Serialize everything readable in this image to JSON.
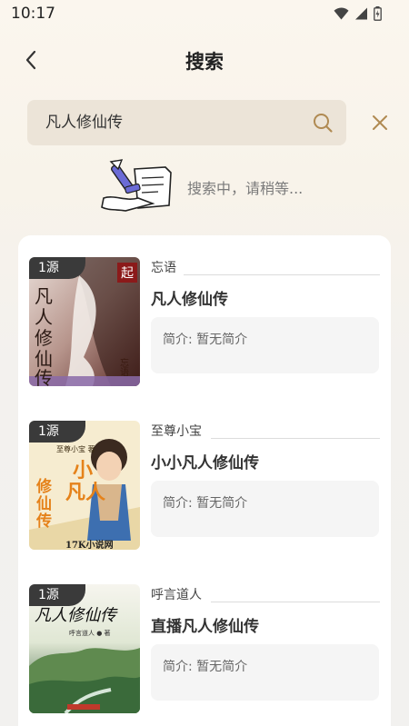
{
  "status_bar": {
    "time": "10:17"
  },
  "header": {
    "title": "搜索"
  },
  "search": {
    "query": "凡人修仙传"
  },
  "status": {
    "text": "搜索中，请稍等..."
  },
  "results": [
    {
      "badge": "1源",
      "author": "忘语",
      "title": "凡人修仙传",
      "intro": "简介: 暂无简介",
      "cover_text": "凡人修仙传",
      "cover_corner_text": "忘语",
      "cover_colors": {
        "bg": "#c9b6ad",
        "accent": "#7a1f1f",
        "text": "#2b1a14"
      }
    },
    {
      "badge": "1源",
      "author": "至尊小宝",
      "title": "小小凡人修仙传",
      "intro": "简介: 暂无简介",
      "cover_text": "小凡人修仙传",
      "cover_corner_text": "17K小说网",
      "cover_author_text": "至尊小宝",
      "cover_colors": {
        "bg": "#f4e8c8",
        "accent": "#e58a12",
        "text": "#d07010"
      }
    },
    {
      "badge": "1源",
      "author": "呼言道人",
      "title": "直播凡人修仙传",
      "intro": "简介: 暂无简介",
      "cover_text": "凡人修仙传",
      "cover_author_text": "呼言道人",
      "cover_colors": {
        "bg": "#dfe8d2",
        "accent": "#3d6b3a",
        "text": "#111111"
      }
    }
  ]
}
